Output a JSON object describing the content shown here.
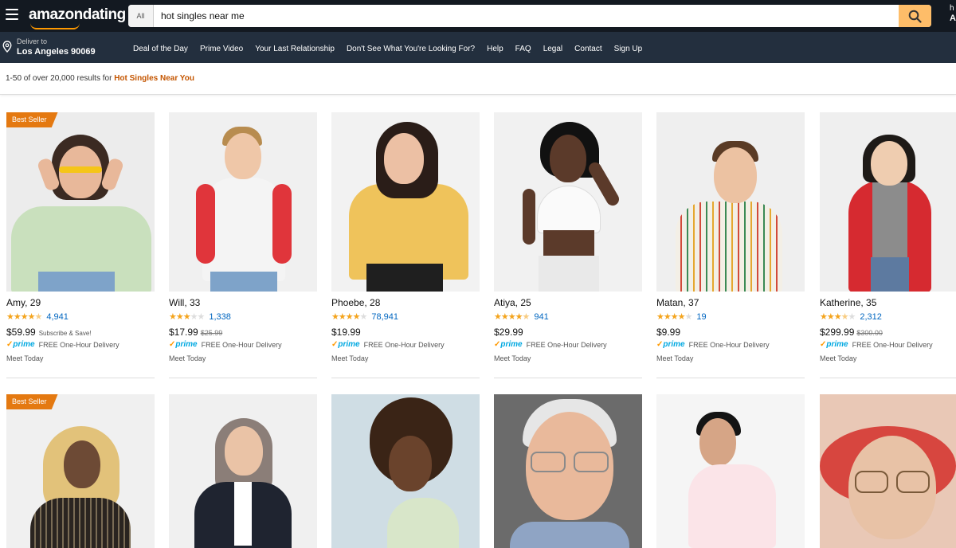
{
  "header": {
    "logo": "amazondating",
    "search_category": "All",
    "search_value": "hot singles near me",
    "right_partial_1": "h",
    "right_partial_2": "A"
  },
  "deliver": {
    "line1": "Deliver to",
    "line2": "Los Angeles 90069"
  },
  "nav": [
    "Deal of the Day",
    "Prime Video",
    "Your Last Relationship",
    "Don't See What You're Looking For?",
    "Help",
    "FAQ",
    "Legal",
    "Contact",
    "Sign Up"
  ],
  "results": {
    "text": "1-50 of over 20,000 results for ",
    "query": "Hot Singles Near You"
  },
  "colors": {
    "header_bg": "#131921",
    "nav_bg": "#232f3e",
    "search_button": "#febd69",
    "badge": "#e47911",
    "link": "#0066c0",
    "star": "#f4a41d",
    "prime": "#00a8e1"
  },
  "prime_label": "prime",
  "delivery_label": "FREE One-Hour Delivery",
  "meet_label": "Meet Today",
  "products": [
    {
      "name": "Amy, 29",
      "stars": 4.5,
      "reviews": "4,941",
      "price": "$59.99",
      "old_price": "",
      "note": "Subscribe & Save!",
      "badge": "Best Seller"
    },
    {
      "name": "Will, 33",
      "stars": 3,
      "reviews": "1,338",
      "price": "$17.99",
      "old_price": "$25.99",
      "note": "",
      "badge": ""
    },
    {
      "name": "Phoebe, 28",
      "stars": 4,
      "reviews": "78,941",
      "price": "$19.99",
      "old_price": "",
      "note": "",
      "badge": ""
    },
    {
      "name": "Atiya, 25",
      "stars": 4.5,
      "reviews": "941",
      "price": "$29.99",
      "old_price": "",
      "note": "",
      "badge": ""
    },
    {
      "name": "Matan, 37",
      "stars": 4,
      "reviews": "19",
      "price": "$9.99",
      "old_price": "",
      "note": "",
      "badge": ""
    },
    {
      "name": "Katherine, 35",
      "stars": 3.5,
      "reviews": "2,312",
      "price": "$299.99",
      "old_price": "$300.00",
      "note": "",
      "badge": ""
    }
  ],
  "row2_badge": "Best Seller"
}
